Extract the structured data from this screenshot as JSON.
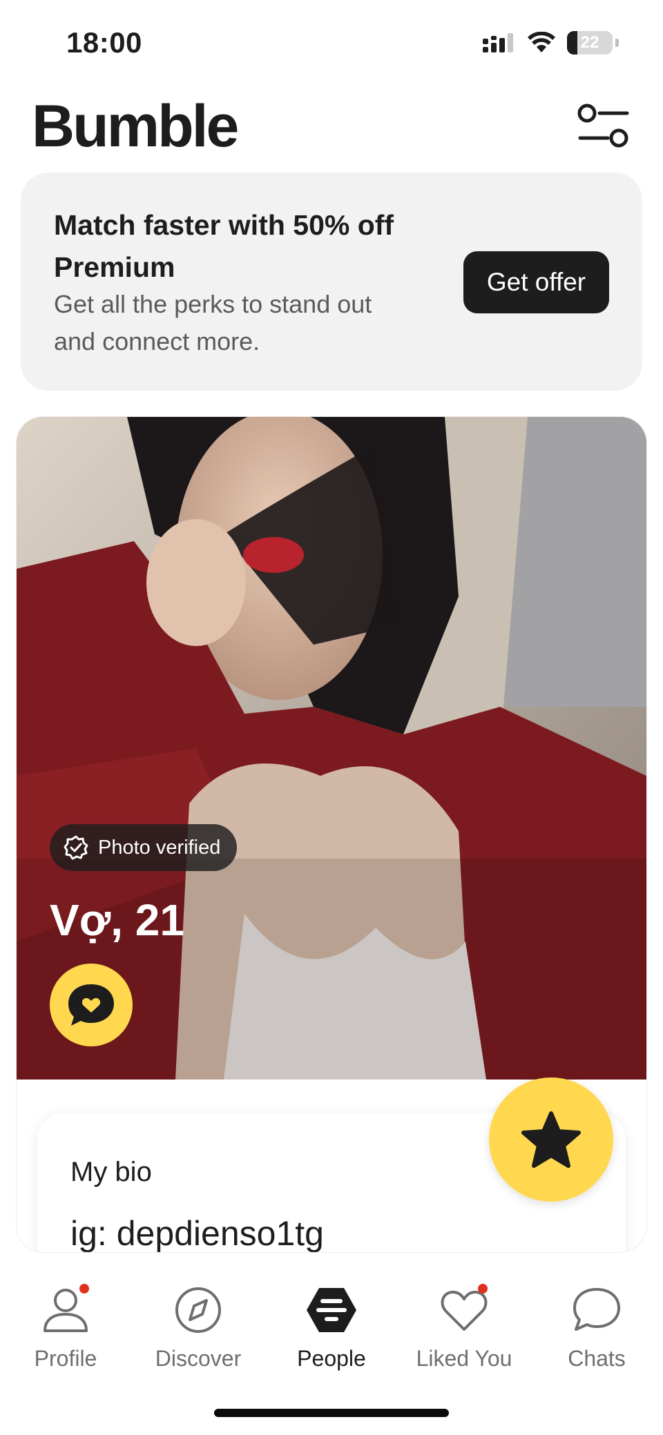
{
  "status_bar": {
    "time": "18:00",
    "battery_level": "22",
    "icons": [
      "cellular-signal-icon",
      "wifi-icon",
      "battery-icon"
    ]
  },
  "header": {
    "title": "Bumble",
    "filter_icon": "filter-sliders-icon"
  },
  "promo": {
    "title": "Match faster with 50% off Premium",
    "subtitle": "Get all the perks to stand out and connect more.",
    "button_label": "Get offer"
  },
  "profile": {
    "verified_label": "Photo verified",
    "name_age": "Vợ, 21",
    "compliment_icon": "heart-speech-bubble-icon",
    "bio_title": "My bio",
    "bio_text": "ig: depdienso1tg",
    "superswipe_icon": "star-icon"
  },
  "nav": {
    "items": [
      {
        "label": "Profile",
        "icon": "person-icon",
        "has_dot": true
      },
      {
        "label": "Discover",
        "icon": "compass-icon",
        "has_dot": false
      },
      {
        "label": "People",
        "icon": "bumble-hive-icon",
        "has_dot": false,
        "active": true
      },
      {
        "label": "Liked You",
        "icon": "heart-icon",
        "has_dot": true
      },
      {
        "label": "Chats",
        "icon": "chat-bubble-icon",
        "has_dot": false
      }
    ]
  },
  "colors": {
    "accent_yellow": "#ffd84f",
    "dark": "#1d1d1d",
    "notification_red": "#e0301e",
    "promo_background": "#f2f2f2"
  }
}
